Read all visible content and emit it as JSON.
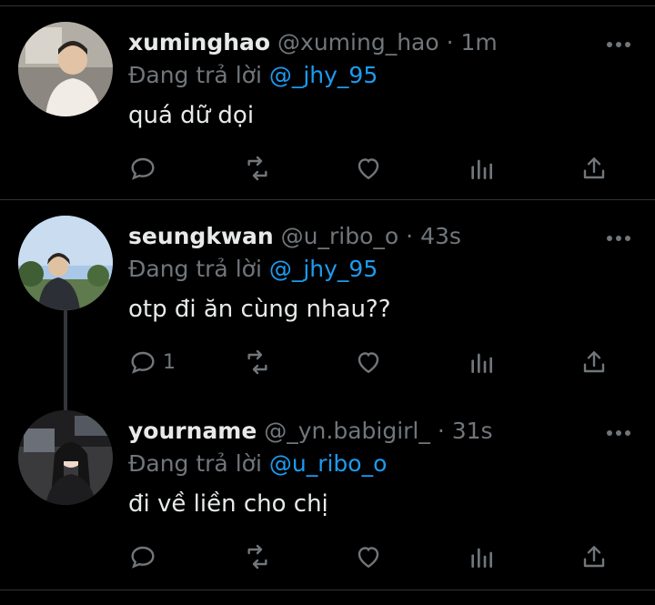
{
  "tweets": [
    {
      "name": "xuminghao",
      "handle": "@xuming_hao",
      "separator": "·",
      "time": "1m",
      "reply_prefix": "Đang trả lời",
      "reply_to": "@_jhy_95",
      "text": "quá dữ dọi",
      "reply_count": ""
    },
    {
      "name": "seungkwan",
      "handle": "@u_ribo_o",
      "separator": "·",
      "time": "43s",
      "reply_prefix": "Đang trả lời",
      "reply_to": "@_jhy_95",
      "text": "otp đi ăn cùng nhau??",
      "reply_count": "1"
    },
    {
      "name": "yourname",
      "handle": "@_yn.babigirl_",
      "separator": "·",
      "time": "31s",
      "reply_prefix": "Đang trả lời",
      "reply_to": "@u_ribo_o",
      "text": "đi về liền cho chị",
      "reply_count": ""
    }
  ],
  "icons": [
    "reply-icon",
    "retweet-icon",
    "like-icon",
    "views-icon",
    "share-icon",
    "more-icon"
  ],
  "colors": {
    "background": "#000000",
    "text": "#e7e9ea",
    "secondary": "#71767b",
    "mention": "#1d9bf0",
    "divider": "#2f3336"
  }
}
